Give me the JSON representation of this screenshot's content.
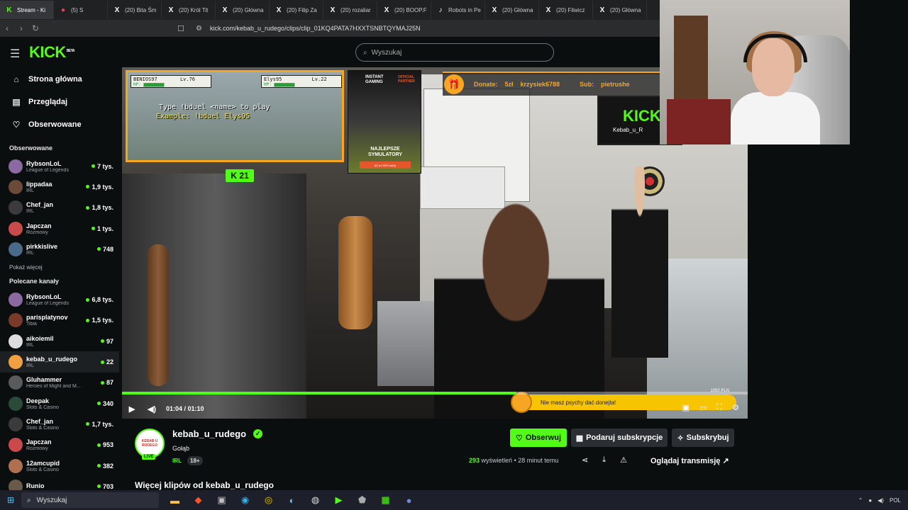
{
  "browser": {
    "tabs": [
      {
        "label": "Stream - Ki",
        "favicon": "K",
        "color": "#53fc18"
      },
      {
        "label": "(5) S",
        "favicon": "●",
        "color": "#ff3b5c",
        "muted": true
      },
      {
        "label": "(20) Bita Śm",
        "favicon": "X",
        "color": "#ffffff"
      },
      {
        "label": "(20) Król Tit",
        "favicon": "X",
        "color": "#ffffff"
      },
      {
        "label": "(20) Główna",
        "favicon": "X",
        "color": "#ffffff"
      },
      {
        "label": "(20) Filip Za",
        "favicon": "X",
        "color": "#ffffff"
      },
      {
        "label": "(20) rozaliar",
        "favicon": "X",
        "color": "#ffffff"
      },
      {
        "label": "(20) BOOP.F",
        "favicon": "X",
        "color": "#ffffff"
      },
      {
        "label": "Robots in Pe",
        "favicon": "♪",
        "color": "#ffffff"
      },
      {
        "label": "(20) Główna",
        "favicon": "X",
        "color": "#ffffff"
      },
      {
        "label": "(20) Filwicz",
        "favicon": "X",
        "color": "#ffffff"
      },
      {
        "label": "(20) Główna",
        "favicon": "X",
        "color": "#ffffff"
      }
    ],
    "url": "kick.com/kebab_u_rudego/clips/clip_01KQ4PATA7HXXTSNBTQYMAJ25N"
  },
  "topbar": {
    "logo": "KICK",
    "logo_badge": "BETA",
    "search_placeholder": "Wyszukaj"
  },
  "nav": {
    "home": "Strona główna",
    "browse": "Przeglądaj",
    "following": "Obserwowane"
  },
  "followed": {
    "title": "Obserwowane",
    "channels": [
      {
        "name": "RybsonLoL",
        "category": "League of Legends",
        "viewers": "7 tys.",
        "color": "#8a6aa0"
      },
      {
        "name": "lippadaa",
        "category": "IRL",
        "viewers": "1,9 tys.",
        "color": "#6b4a3a"
      },
      {
        "name": "Chef_jan",
        "category": "IRL",
        "viewers": "1,8 tys.",
        "color": "#3b3b3b"
      },
      {
        "name": "Japczan",
        "category": "Rozmowy",
        "viewers": "1 tys.",
        "color": "#c94a4a"
      },
      {
        "name": "pirkkislive",
        "category": "IRL",
        "viewers": "748",
        "color": "#4a6a8a"
      }
    ],
    "show_more": "Pokaż więcej"
  },
  "recommended": {
    "title": "Polecane kanały",
    "channels": [
      {
        "name": "RybsonLoL",
        "category": "League of Legends",
        "viewers": "6,8 tys.",
        "color": "#8a6aa0"
      },
      {
        "name": "parisplatynov",
        "category": "Tibia",
        "viewers": "1,5 tys.",
        "color": "#7a3a2a"
      },
      {
        "name": "aikoiemil",
        "category": "IRL",
        "viewers": "97",
        "color": "#ddd"
      },
      {
        "name": "kebab_u_rudego",
        "category": "IRL",
        "viewers": "22",
        "color": "#f0a040",
        "selected": true
      },
      {
        "name": "Gluhammer",
        "category": "Heroes of Might and M...",
        "viewers": "87",
        "color": "#5a5a5a"
      },
      {
        "name": "Deepak",
        "category": "Slots & Casino",
        "viewers": "340",
        "color": "#2a4a3a"
      },
      {
        "name": "Chef_jan",
        "category": "Slots & Casino",
        "viewers": "1,7 tys.",
        "color": "#3b3b3b"
      },
      {
        "name": "Japczan",
        "category": "Rozmowy",
        "viewers": "953",
        "color": "#c94a4a"
      },
      {
        "name": "12amcupid",
        "category": "Slots & Casino",
        "viewers": "382",
        "color": "#b07050"
      },
      {
        "name": "Runio",
        "category": "",
        "viewers": "703",
        "color": "#6a5a4a"
      }
    ]
  },
  "video": {
    "overlay_game": {
      "player1": "BENIOS97",
      "player1_lv": "Lv.76",
      "player2": "Elys95",
      "player2_lv": "Lv.22",
      "hp_label": "HP:",
      "line1": "Type !bduel <name> to play",
      "line2": "Example: !bduel Elys95"
    },
    "kick_badge": "21",
    "ad": {
      "brand": "INSTANT GAMING",
      "partner": "OFFICIAL PARTNER",
      "promo": "NAJLEPSZE SYMULATORY",
      "cta": "AŻ do 90% taniej"
    },
    "ticker": {
      "donate_label": "Donate:",
      "donate_value": "5zł",
      "donate_user": "krzysiek6788",
      "sub_label": "Sub:",
      "sub_user": "pietrushe"
    },
    "tv_logo": "KICK",
    "tv_sub": "Kebab_u_R",
    "donate_bar": "Nie masz psychy dać donejta!",
    "donate_amount": "1050 PLN",
    "time": "01:04 / 01:10",
    "progress": 0.63
  },
  "channel": {
    "name": "kebab_u_rudego",
    "avatar_text": "KEBAB U RUDEGO",
    "live": "LIVE",
    "clip_title": "Gołąb",
    "category": "IRL",
    "age": "18+",
    "follow": "Obserwuj",
    "gift": "Podaruj subskrypcje",
    "subscribe": "Subskrybuj",
    "views": "293",
    "views_label": "wyświetleń",
    "ago": "28 minut temu",
    "watch": "Oglądaj transmisję",
    "more_clips": "Więcej klipów od kebab_u_rudego"
  },
  "taskbar": {
    "search": "Wyszukaj",
    "lang": "POL",
    "apps": [
      {
        "icon": "folder-icon",
        "glyph": "▬",
        "color": "#f2c14e"
      },
      {
        "icon": "brave-icon",
        "glyph": "◆",
        "color": "#fb542b"
      },
      {
        "icon": "app-icon",
        "glyph": "▣",
        "color": "#c0c0c0"
      },
      {
        "icon": "edge-icon",
        "glyph": "◉",
        "color": "#35b2e6"
      },
      {
        "icon": "chrome-icon",
        "glyph": "◎",
        "color": "#f4c20d"
      },
      {
        "icon": "steam-icon",
        "glyph": "◐",
        "color": "#66c0f4"
      },
      {
        "icon": "obs-icon",
        "glyph": "◍",
        "color": "#dddddd"
      },
      {
        "icon": "play-icon",
        "glyph": "▶",
        "color": "#53fc18"
      },
      {
        "icon": "shield-icon",
        "glyph": "⬟",
        "color": "#aaaaaa"
      },
      {
        "icon": "kick-icon",
        "glyph": "▦",
        "color": "#53fc18"
      },
      {
        "icon": "discord-icon",
        "glyph": "●",
        "color": "#7289da"
      }
    ]
  }
}
